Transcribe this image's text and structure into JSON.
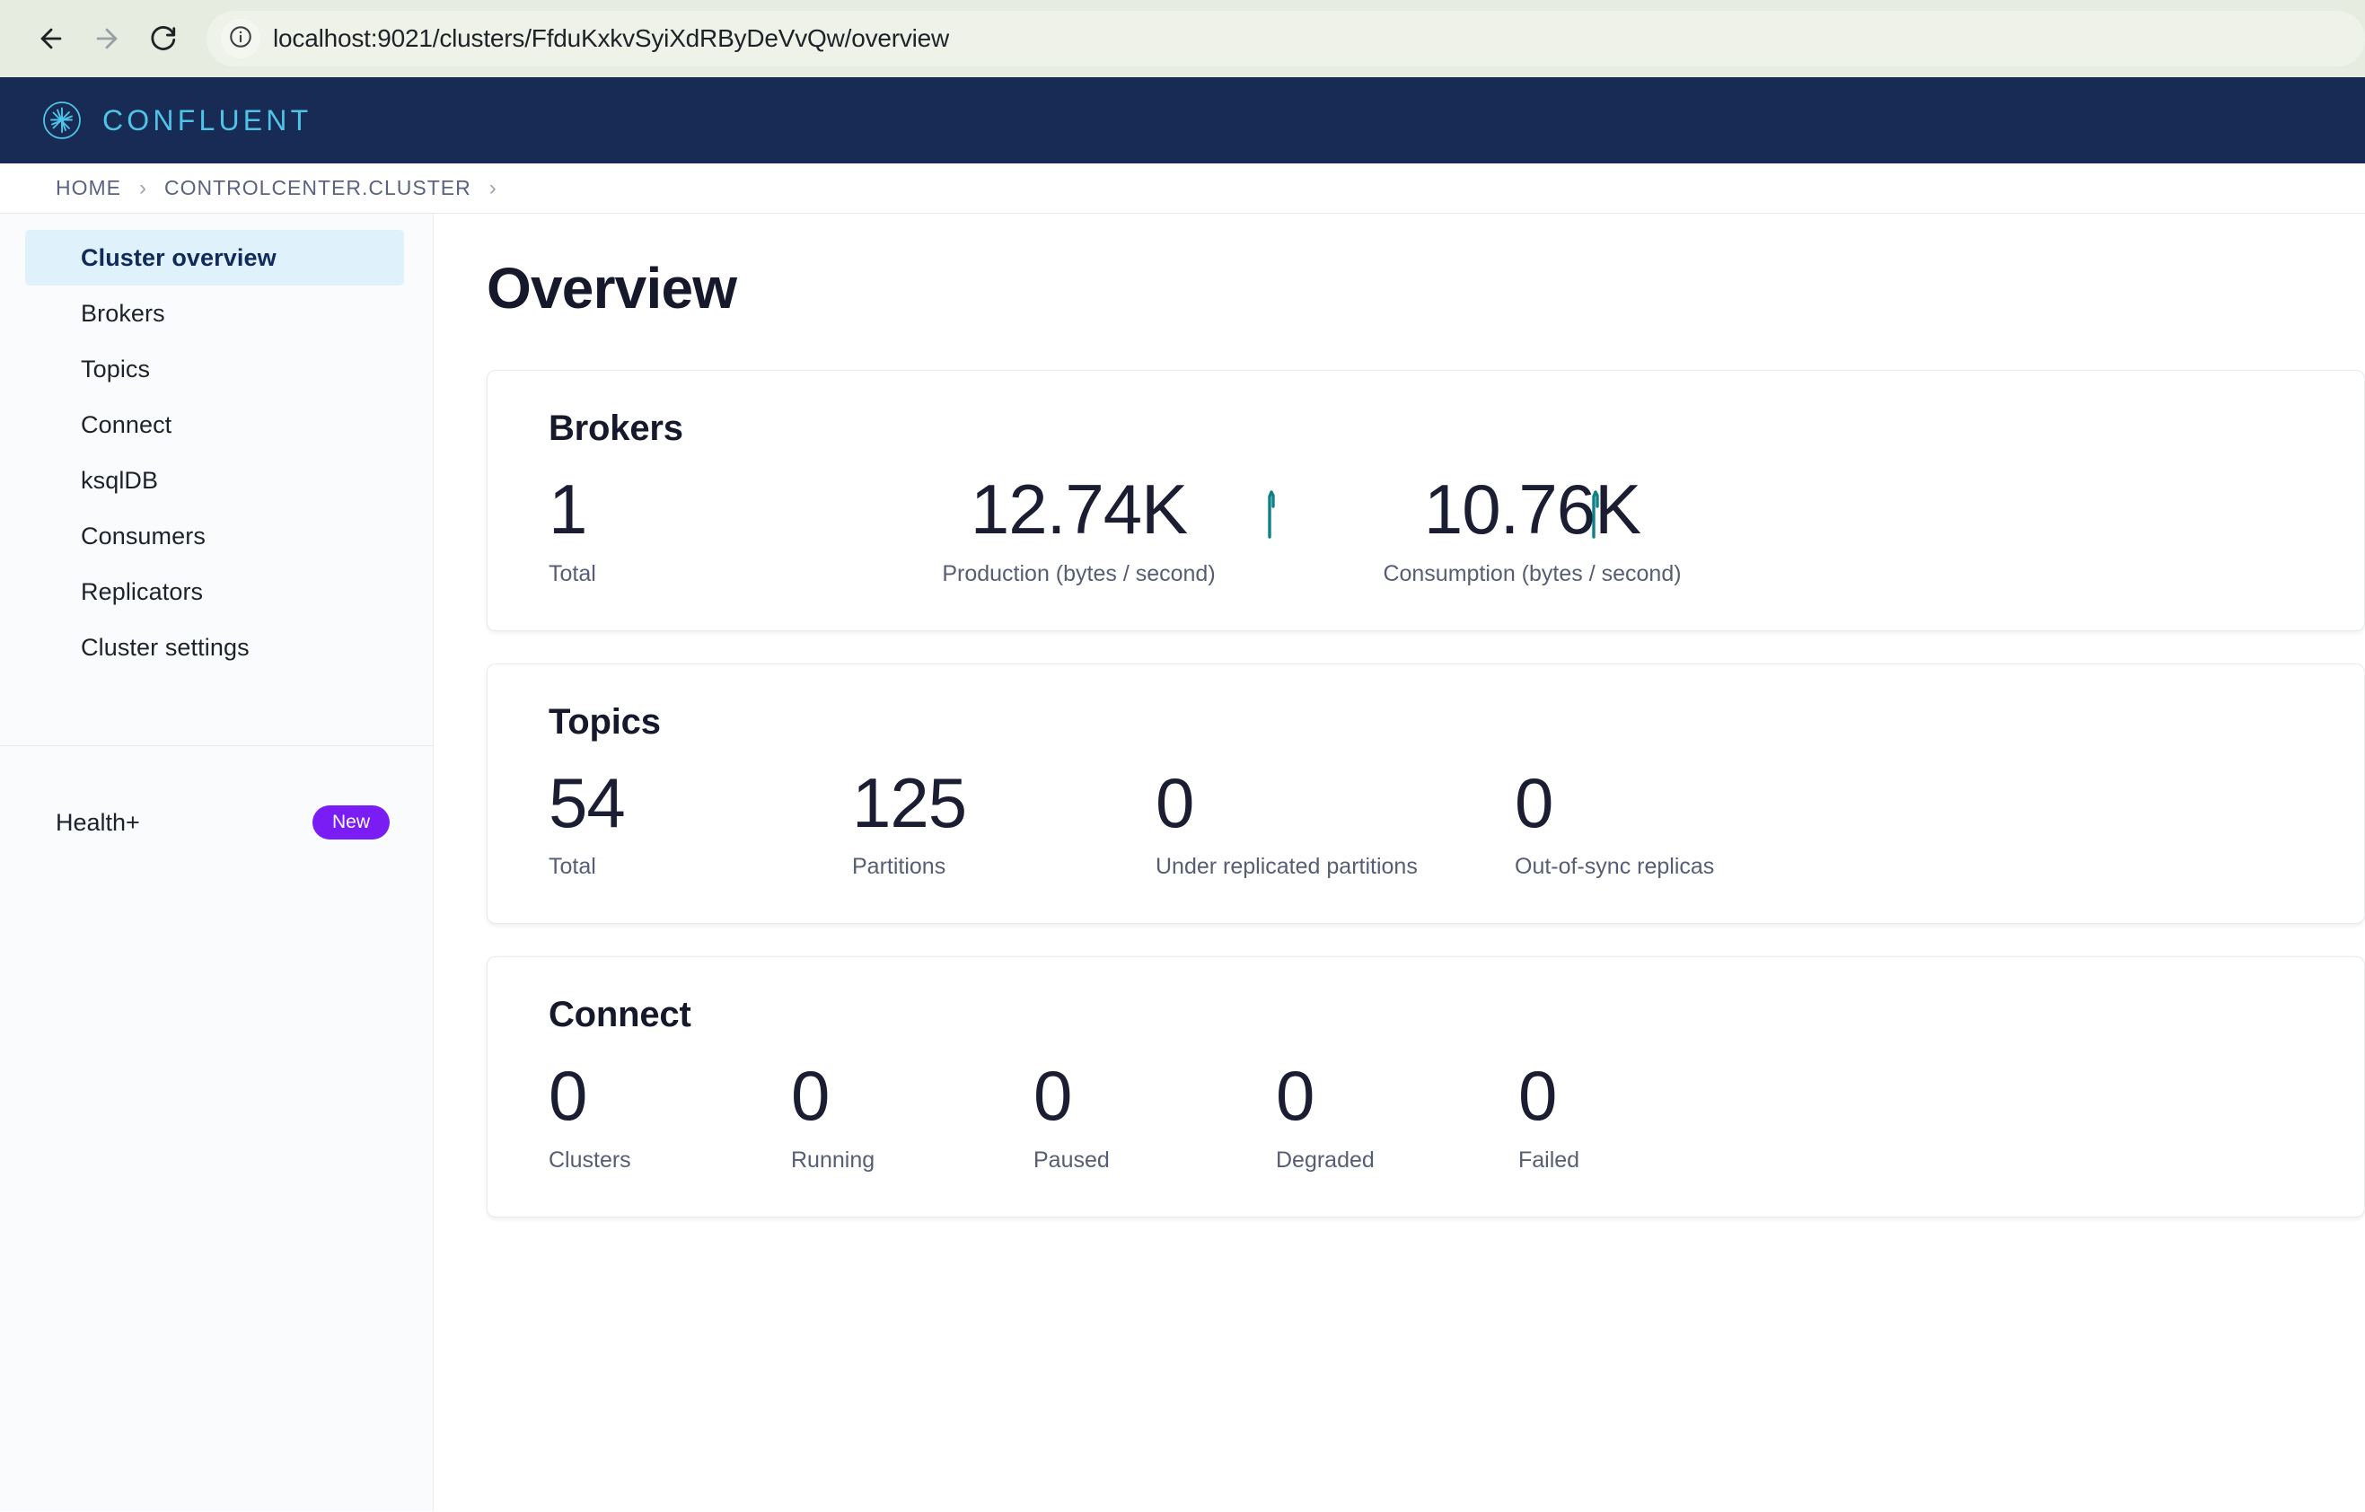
{
  "browser": {
    "url": "localhost:9021/clusters/FfduKxkvSyiXdRByDeVvQw/overview",
    "back_icon": "back-arrow-icon",
    "forward_icon": "forward-arrow-icon",
    "reload_icon": "reload-icon",
    "site_info_icon": "info-circle-icon",
    "chrome_bg": "#e7ece0"
  },
  "header": {
    "brand": "CONFLUENT",
    "logo_icon": "confluent-starburst-logo",
    "bg": "#172b54",
    "accent": "#4fc3e8"
  },
  "breadcrumb": {
    "items": [
      "HOME",
      "CONTROLCENTER.CLUSTER"
    ],
    "separator": "›"
  },
  "sidebar": {
    "items": [
      {
        "label": "Cluster overview",
        "active": true
      },
      {
        "label": "Brokers",
        "active": false
      },
      {
        "label": "Topics",
        "active": false
      },
      {
        "label": "Connect",
        "active": false
      },
      {
        "label": "ksqlDB",
        "active": false
      },
      {
        "label": "Consumers",
        "active": false
      },
      {
        "label": "Replicators",
        "active": false
      },
      {
        "label": "Cluster settings",
        "active": false
      }
    ],
    "active_bg": "#dff1fb",
    "health": {
      "label": "Health+",
      "badge": "New",
      "badge_color": "#7a1df5"
    }
  },
  "main": {
    "title": "Overview",
    "cards": [
      {
        "title": "Brokers",
        "metrics": [
          {
            "value": "1",
            "label": "Total",
            "spark": false
          },
          {
            "value": "12.74K",
            "label": "Production (bytes / second)",
            "spark": true
          },
          {
            "value": "10.76K",
            "label": "Consumption (bytes / second)",
            "spark": true
          }
        ]
      },
      {
        "title": "Topics",
        "metrics": [
          {
            "value": "54",
            "label": "Total",
            "spark": false
          },
          {
            "value": "125",
            "label": "Partitions",
            "spark": false
          },
          {
            "value": "0",
            "label": "Under replicated partitions",
            "spark": false
          },
          {
            "value": "0",
            "label": "Out-of-sync replicas",
            "spark": false
          }
        ]
      },
      {
        "title": "Connect",
        "metrics": [
          {
            "value": "0",
            "label": "Clusters",
            "spark": false
          },
          {
            "value": "0",
            "label": "Running",
            "spark": false
          },
          {
            "value": "0",
            "label": "Paused",
            "spark": false
          },
          {
            "value": "0",
            "label": "Degraded",
            "spark": false
          },
          {
            "value": "0",
            "label": "Failed",
            "spark": false
          }
        ]
      }
    ],
    "spark_color": "#0d8089"
  }
}
